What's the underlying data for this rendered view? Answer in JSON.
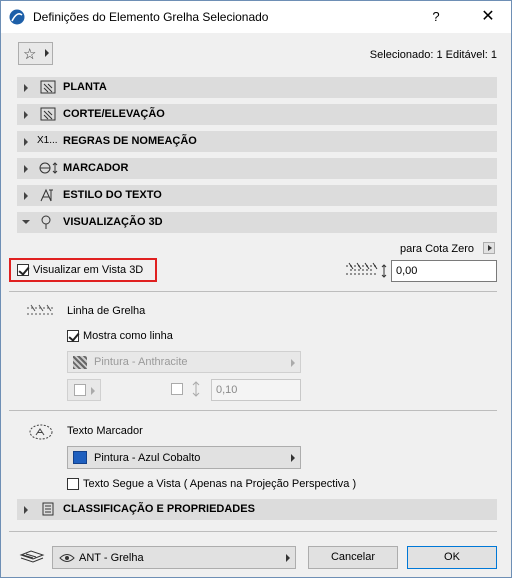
{
  "window": {
    "title": "Definições do Elemento Grelha Selecionado",
    "help": "?",
    "close": "✕"
  },
  "header": {
    "selection_info": "Selecionado: 1 Editável: 1"
  },
  "sections": [
    {
      "label": "PLANTA",
      "expanded": false
    },
    {
      "label": "CORTE/ELEVAÇÃO",
      "expanded": false
    },
    {
      "label": "REGRAS DE NOMEAÇÃO",
      "expanded": false,
      "icon_text": "X1..."
    },
    {
      "label": "MARCADOR",
      "expanded": false
    },
    {
      "label": "ESTILO DO TEXTO",
      "expanded": false
    },
    {
      "label": "VISUALIZAÇÃO 3D",
      "expanded": true
    },
    {
      "label": "CLASSIFICAÇÃO E PROPRIEDADES",
      "expanded": false
    }
  ],
  "view3d": {
    "show_in_3d_label": "Visualizar em Vista 3D",
    "show_in_3d_checked": true,
    "zero_level_label": "para Cota Zero",
    "elevation_value": "0,00",
    "grid_line_title": "Linha de Grelha",
    "show_as_line_label": "Mostra como linha",
    "show_as_line_checked": true,
    "line_pen": "Pintura - Anthracite",
    "line_width_value": "0,10",
    "marker_text_title": "Texto Marcador",
    "marker_pen": "Pintura - Azul Cobalto",
    "marker_pen_color": "#1e5fbf",
    "follow_view_label": "Texto Segue a Vista ( Apenas na Projeção Perspectiva )",
    "follow_view_checked": false
  },
  "footer": {
    "layer": "ANT - Grelha",
    "cancel": "Cancelar",
    "ok": "OK"
  },
  "colors": {
    "accent": "#0078d7",
    "highlight": "#e02020",
    "section_bg": "#dcdcdc"
  }
}
